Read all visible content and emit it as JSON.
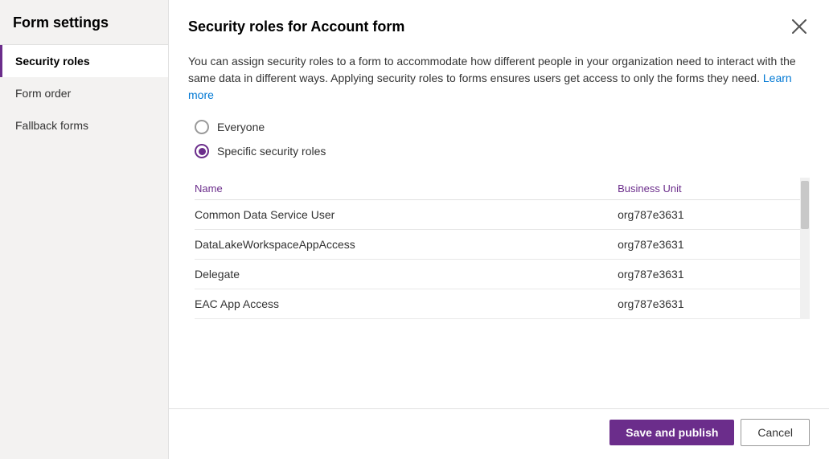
{
  "sidebar": {
    "title": "Form settings",
    "items": [
      {
        "id": "security-roles",
        "label": "Security roles",
        "active": true
      },
      {
        "id": "form-order",
        "label": "Form order",
        "active": false
      },
      {
        "id": "fallback-forms",
        "label": "Fallback forms",
        "active": false
      }
    ]
  },
  "dialog": {
    "title": "Security roles for Account form",
    "description1": "You can assign security roles to a form to accommodate how different people in your organization need to interact with the same data in different ways. Applying security roles to forms ensures users get access to only the forms they need.",
    "learn_more_text": "Learn more",
    "radio_options": [
      {
        "id": "everyone",
        "label": "Everyone",
        "selected": false
      },
      {
        "id": "specific",
        "label": "Specific security roles",
        "selected": true
      }
    ],
    "table": {
      "columns": [
        {
          "id": "name",
          "label": "Name"
        },
        {
          "id": "business_unit",
          "label": "Business Unit"
        }
      ],
      "rows": [
        {
          "name": "Common Data Service User",
          "business_unit": "org787e3631"
        },
        {
          "name": "DataLakeWorkspaceAppAccess",
          "business_unit": "org787e3631"
        },
        {
          "name": "Delegate",
          "business_unit": "org787e3631"
        },
        {
          "name": "EAC App Access",
          "business_unit": "org787e3631"
        }
      ]
    },
    "footer": {
      "save_label": "Save and publish",
      "cancel_label": "Cancel"
    }
  }
}
